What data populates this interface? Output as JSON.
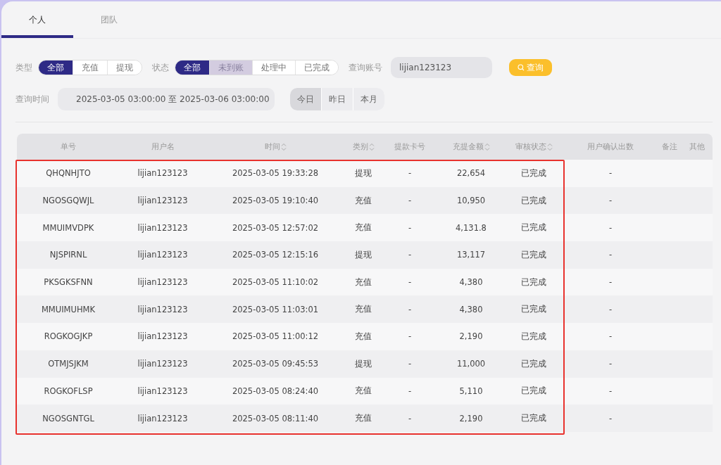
{
  "tabs": [
    {
      "label": "个人",
      "selected": true
    },
    {
      "label": "团队",
      "selected": false
    }
  ],
  "filters": {
    "type_label": "类型",
    "type_options": [
      {
        "label": "全部",
        "selected": true,
        "highlighted": false
      },
      {
        "label": "充值",
        "selected": false,
        "highlighted": false
      },
      {
        "label": "提现",
        "selected": false,
        "highlighted": false
      }
    ],
    "status_label": "状态",
    "status_options": [
      {
        "label": "全部",
        "selected": true,
        "highlighted": false
      },
      {
        "label": "未到账",
        "selected": false,
        "highlighted": true
      },
      {
        "label": "处理中",
        "selected": false,
        "highlighted": false
      },
      {
        "label": "已完成",
        "selected": false,
        "highlighted": false
      }
    ],
    "account_label": "查询账号",
    "account_value": "lijian123123",
    "search_button": "查询",
    "time_label": "查询时间",
    "date_range": "2025-03-05 03:00:00 至 2025-03-06 03:00:00",
    "quick_ranges": [
      {
        "label": "今日",
        "selected": true
      },
      {
        "label": "昨日",
        "selected": false
      },
      {
        "label": "本月",
        "selected": false
      }
    ]
  },
  "table": {
    "columns": [
      {
        "label": "单号",
        "sortable": false
      },
      {
        "label": "用户名",
        "sortable": false
      },
      {
        "label": "时间",
        "sortable": true
      },
      {
        "label": "类别",
        "sortable": true
      },
      {
        "label": "提款卡号",
        "sortable": false
      },
      {
        "label": "充提金额",
        "sortable": true
      },
      {
        "label": "审核状态",
        "sortable": true
      },
      {
        "label": "用户确认出数",
        "sortable": false
      },
      {
        "label": "备注",
        "sortable": false
      },
      {
        "label": "其他",
        "sortable": false
      }
    ],
    "rows": [
      [
        "QHQNHJTO",
        "lijian123123",
        "2025-03-05 19:33:28",
        "提现",
        "-",
        "22,654",
        "已完成",
        "-"
      ],
      [
        "NGOSGQWJL",
        "lijian123123",
        "2025-03-05 19:10:40",
        "充值",
        "-",
        "10,950",
        "已完成",
        "-"
      ],
      [
        "MMUIMVDPK",
        "lijian123123",
        "2025-03-05 12:57:02",
        "充值",
        "-",
        "4,131.8",
        "已完成",
        "-"
      ],
      [
        "NJSPIRNL",
        "lijian123123",
        "2025-03-05 12:15:16",
        "提现",
        "-",
        "13,117",
        "已完成",
        "-"
      ],
      [
        "PKSGKSFNN",
        "lijian123123",
        "2025-03-05 11:10:02",
        "充值",
        "-",
        "4,380",
        "已完成",
        "-"
      ],
      [
        "MMUIMUHMK",
        "lijian123123",
        "2025-03-05 11:03:01",
        "充值",
        "-",
        "4,380",
        "已完成",
        "-"
      ],
      [
        "ROGKOGJKP",
        "lijian123123",
        "2025-03-05 11:00:12",
        "充值",
        "-",
        "2,190",
        "已完成",
        "-"
      ],
      [
        "OTMJSJKM",
        "lijian123123",
        "2025-03-05 09:45:53",
        "提现",
        "-",
        "11,000",
        "已完成",
        "-"
      ],
      [
        "ROGKOFLSP",
        "lijian123123",
        "2025-03-05 08:24:40",
        "充值",
        "-",
        "5,110",
        "已完成",
        "-"
      ],
      [
        "NGOSGNTGL",
        "lijian123123",
        "2025-03-05 08:11:40",
        "充值",
        "-",
        "2,190",
        "已完成",
        "-"
      ]
    ],
    "highlight_box": true
  }
}
